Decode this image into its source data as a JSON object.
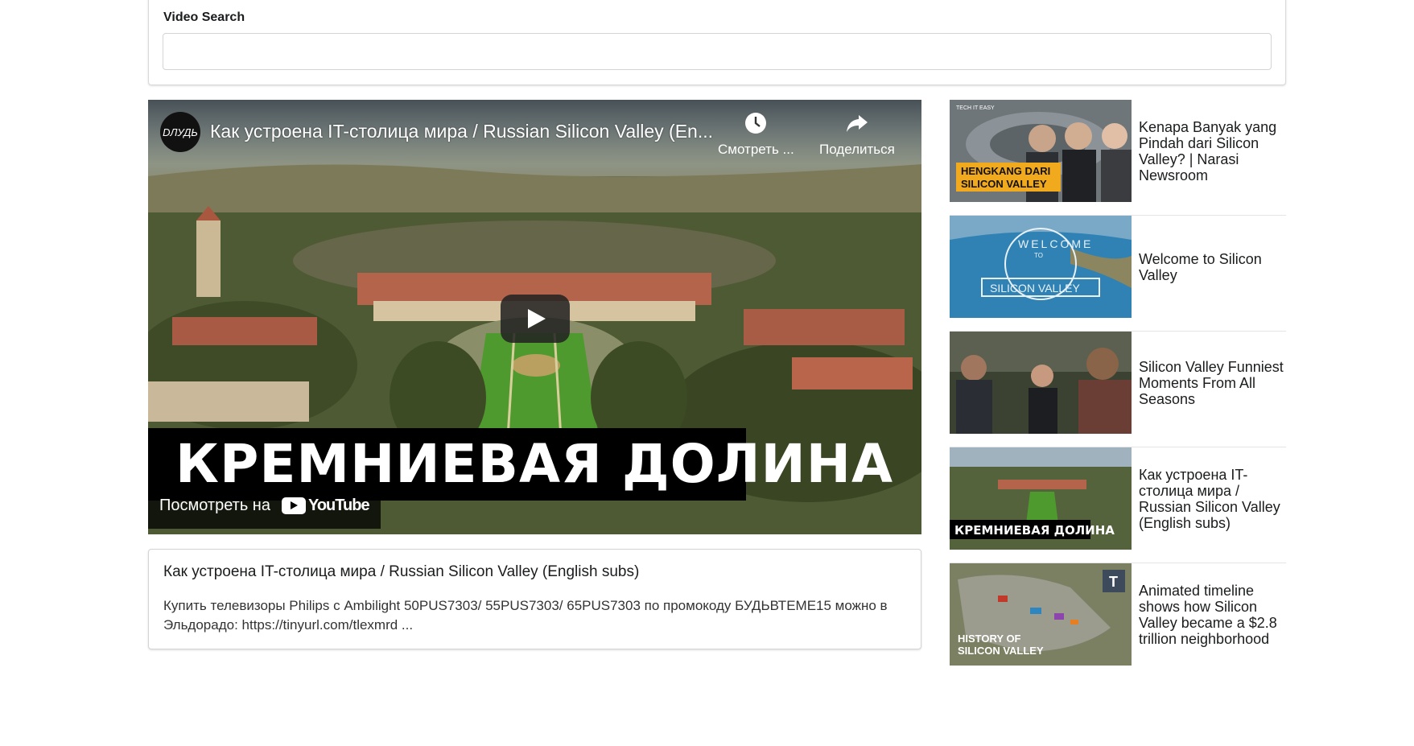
{
  "search": {
    "label": "Video Search",
    "value": "",
    "placeholder": ""
  },
  "player": {
    "channel_avatar_text": "DЛУДЬ",
    "title": "Как устроена IT-столица мира / Russian Silicon Valley (En...",
    "watch_later_label": "Смотреть ...",
    "share_label": "Поделиться",
    "overlay_text": "КРЕМНИЕВАЯ ДОЛИНА",
    "watch_on_label": "Посмотреть на",
    "youtube_label": "YouTube"
  },
  "selected_video": {
    "title": "Как устроена IT-столица мира / Russian Silicon Valley (English subs)",
    "description": "Купить телевизоры Philips с Ambilight 50PUS7303/ 55PUS7303/ 65PUS7303 по промокоду БУДЬВТЕМЕ15 можно в Эльдорадо: https://tinyurl.com/tlexmrd ..."
  },
  "video_list": [
    {
      "title": "Kenapa Banyak yang Pindah dari Silicon Valley? | Narasi Newsroom",
      "thumb_caption_1": "HENGKANG DARI",
      "thumb_caption_2": "SILICON VALLEY",
      "thumb_corner": "TECH IT EASY"
    },
    {
      "title": "Welcome to Silicon Valley",
      "thumb_caption_1": "WELCOME",
      "thumb_caption_2": "TO",
      "thumb_caption_3": "SILICON VALLEY"
    },
    {
      "title": "Silicon Valley Funniest Moments From All Seasons"
    },
    {
      "title": "Как устроена IT-столица мира / Russian Silicon Valley (English subs)",
      "thumb_caption_1": "КРЕМНИЕВАЯ ДОЛИНА"
    },
    {
      "title": "Animated timeline shows how Silicon Valley became a $2.8 trillion neighborhood",
      "thumb_caption_1": "HISTORY OF",
      "thumb_caption_2": "SILICON VALLEY",
      "thumb_badge": "T"
    }
  ],
  "icons": {
    "watch_later": "clock-icon",
    "share": "share-arrow-icon",
    "play": "play-icon"
  }
}
